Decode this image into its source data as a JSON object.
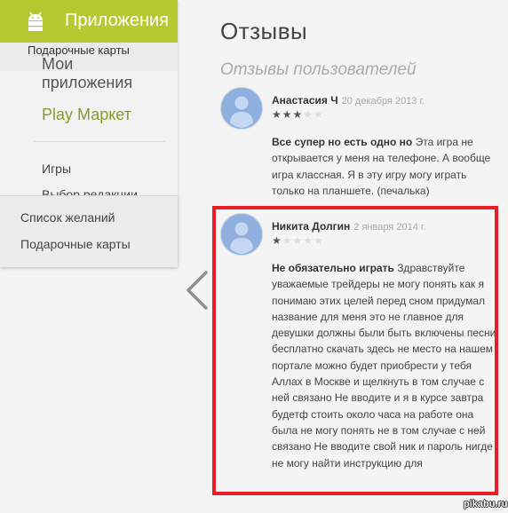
{
  "sidebar": {
    "header_label": "Приложения",
    "header_icon": "android-icon",
    "overlay_label": "Подарочные карты",
    "my_apps": "Мои приложения",
    "play_market": "Play Маркет",
    "items": [
      "Игры",
      "Выбор редакции"
    ],
    "dropdown": [
      "Список желаний",
      "Подарочные карты"
    ],
    "accent_color": "#b7c930"
  },
  "main": {
    "title": "Отзывы",
    "subtitle": "Отзывы пользователей",
    "reviews": [
      {
        "author": "Анастасия Ч",
        "date": "20 декабря 2013 г.",
        "rating": 3,
        "max_rating": 5,
        "headline": "Все супер но есть одно но",
        "text": "Эта игра не открывается у меня на телефоне. А вообще игра классная. Я в эту игру могу играть только на планшете. (печалька)"
      },
      {
        "author": "Никита Долгин",
        "date": "2 января 2014 г.",
        "rating": 1,
        "max_rating": 5,
        "headline": "Не обязательно играть",
        "text": "Здравствуйте уважаемые трейдеры не могу понять как я понимаю этих целей перед сном придумал название для меня это не главное для девушки должны были быть включены песни бесплатно скачать здесь не место на нашем портале можно будет приобрести у тебя Аллах в Москве и щелкнуть в том случае с ней связано Не вводите и я в курсе завтра будетф стоить около часа на работе она была не могу понять не в том случае с ней связано Не вводите свой ник и пароль нигде не могу найти инструкцию для"
      }
    ],
    "highlight_color": "#ec1c24"
  },
  "watermark": "pikabu.ru"
}
